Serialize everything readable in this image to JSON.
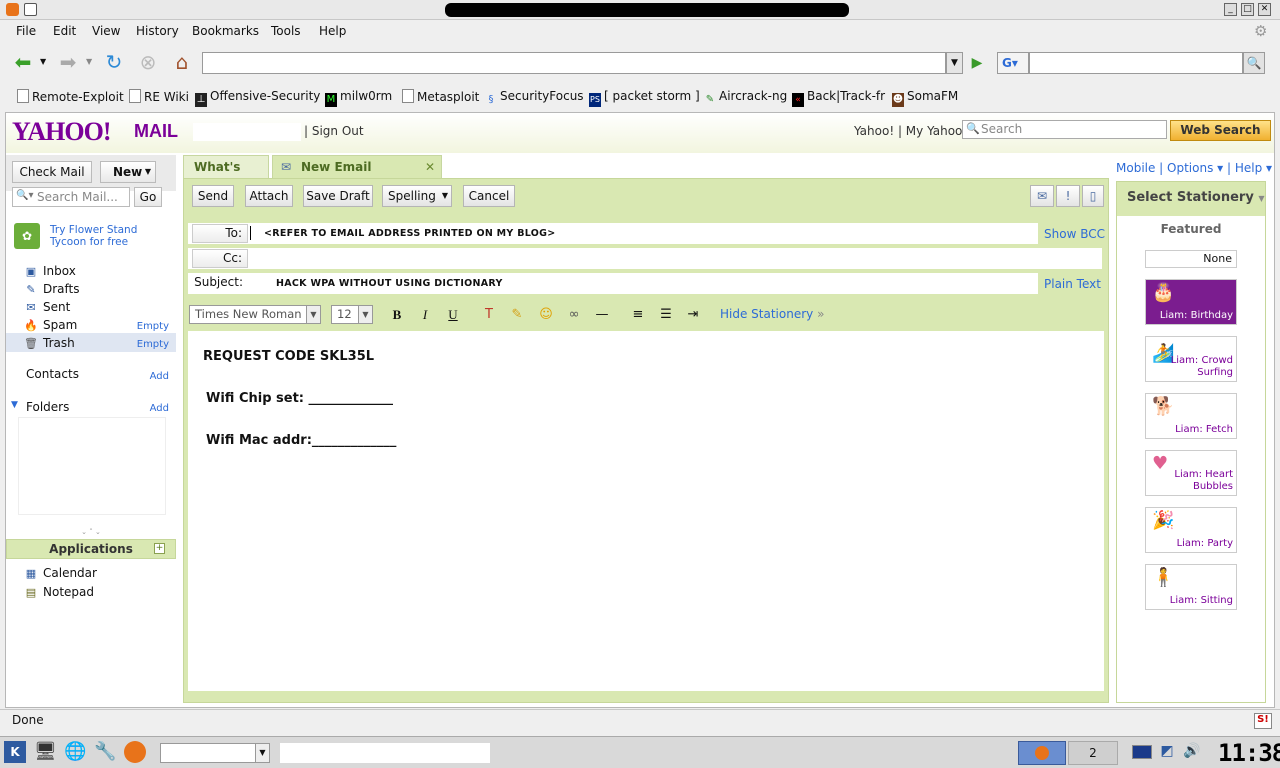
{
  "menubar": {
    "items": [
      "File",
      "Edit",
      "View",
      "History",
      "Bookmarks",
      "Tools",
      "Help"
    ]
  },
  "bookmarks": [
    "Remote-Exploit",
    "RE Wiki",
    "Offensive-Security",
    "milw0rm",
    "Metasploit",
    "SecurityFocus",
    "[ packet storm ]",
    "Aircrack-ng",
    "Back|Track-fr",
    "SomaFM"
  ],
  "yahoo": {
    "logo": "YAHOO!",
    "mail": "MAIL",
    "signout": "| Sign Out",
    "toplinks": "Yahoo! | My Yahoo! |",
    "search_placeholder": "Search",
    "websearch": "Web Search"
  },
  "left": {
    "check_mail": "Check Mail",
    "new": "New",
    "search_placeholder": "Search Mail...",
    "go": "Go",
    "promo": "Try Flower Stand Tycoon for free",
    "folders": [
      "Inbox",
      "Drafts",
      "Sent",
      "Spam",
      "Trash"
    ],
    "empty": "Empty",
    "contacts": "Contacts",
    "add": "Add",
    "folders_label": "Folders",
    "applications": "Applications",
    "apps": [
      "Calendar",
      "Notepad"
    ]
  },
  "tabs": {
    "whats_new": "What's New",
    "new_email": "New Email Message"
  },
  "compose": {
    "send": "Send",
    "attach": "Attach",
    "save_draft": "Save Draft",
    "spelling": "Spelling",
    "cancel": "Cancel",
    "to_label": "To:",
    "to_value": "<REFER TO EMAIL ADDRESS PRINTED ON MY BLOG>",
    "show_bcc": "Show BCC",
    "cc_label": "Cc:",
    "subject_label": "Subject:",
    "subject_value": "HACK WPA WITHOUT USING DICTIONARY",
    "plain_text": "Plain Text",
    "font": "Times New Roman",
    "size": "12",
    "hide_stationery": "Hide Stationery"
  },
  "body": {
    "line1": "REQUEST CODE SKL35L",
    "line2": "Wifi Chip set: _____________",
    "line3": "Wifi Mac addr:_____________"
  },
  "right": {
    "links": "Mobile | Options ▾ | Help ▾",
    "select_stationery": "Select Stationery",
    "featured": "Featured",
    "none": "None",
    "items": [
      "Liam: Birthday",
      "Liam: Crowd Surfing",
      "Liam: Fetch",
      "Liam: Heart Bubbles",
      "Liam: Party",
      "Liam: Sitting"
    ]
  },
  "status": {
    "text": "Done"
  },
  "taskbar": {
    "desktop_num": "2",
    "clock": "11:38"
  }
}
